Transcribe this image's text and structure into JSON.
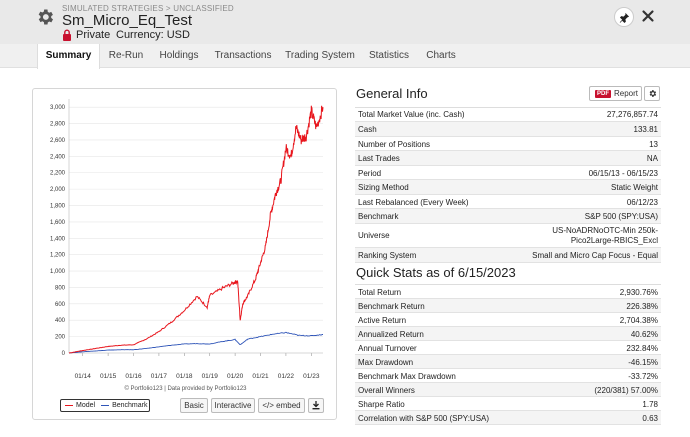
{
  "header": {
    "breadcrumb": "SIMULATED STRATEGIES > UNCLASSIFIED",
    "title": "Sm_Micro_Eq_Test",
    "privacy": "Private",
    "currency": "Currency: USD"
  },
  "tabs": [
    "Summary",
    "Re-Run",
    "Holdings",
    "Transactions",
    "Trading System",
    "Statistics",
    "Charts"
  ],
  "active_tab": "Summary",
  "chart": {
    "credit": "© Portfolio123 | Data provided by Portfolio123",
    "legend_model": "Model",
    "legend_benchmark": "Benchmark",
    "btn_basic": "Basic",
    "btn_interactive": "Interactive",
    "btn_embed": "</> embed",
    "colors": {
      "model": "#e8161d",
      "benchmark": "#2f55b8"
    }
  },
  "chart_data": {
    "type": "line",
    "x_ticks": [
      "01/14",
      "01/15",
      "01/16",
      "01/17",
      "01/18",
      "01/19",
      "01/20",
      "01/21",
      "01/22",
      "01/23"
    ],
    "y_ticks": [
      0,
      200,
      400,
      600,
      800,
      1000,
      1200,
      1400,
      1600,
      1800,
      2000,
      2200,
      2400,
      2600,
      2800,
      3000
    ],
    "ylim": [
      0,
      3100
    ],
    "x_range": [
      2013.46,
      2023.46
    ],
    "series": [
      {
        "name": "Model",
        "x": [
          2013.46,
          2014.0,
          2014.5,
          2015.0,
          2015.5,
          2016.0,
          2016.5,
          2017.0,
          2017.5,
          2018.0,
          2018.5,
          2018.9,
          2019.0,
          2019.5,
          2019.9,
          2020.1,
          2020.2,
          2020.3,
          2020.5,
          2020.8,
          2021.0,
          2021.2,
          2021.4,
          2021.6,
          2021.8,
          2022.0,
          2022.2,
          2022.4,
          2022.6,
          2022.8,
          2023.0,
          2023.2,
          2023.46
        ],
        "y": [
          0,
          30,
          55,
          80,
          95,
          100,
          170,
          260,
          380,
          520,
          690,
          560,
          700,
          790,
          850,
          880,
          400,
          600,
          700,
          900,
          1100,
          1300,
          1700,
          1950,
          2100,
          2500,
          2400,
          2750,
          2600,
          2650,
          2950,
          2750,
          3000
        ]
      },
      {
        "name": "Benchmark",
        "x": [
          2013.46,
          2014.0,
          2014.5,
          2015.0,
          2015.5,
          2016.0,
          2016.5,
          2017.0,
          2017.5,
          2018.0,
          2018.5,
          2019.0,
          2019.5,
          2020.0,
          2020.2,
          2020.5,
          2021.0,
          2021.5,
          2022.0,
          2022.5,
          2023.0,
          2023.46
        ],
        "y": [
          0,
          15,
          25,
          35,
          40,
          40,
          55,
          75,
          95,
          110,
          115,
          110,
          140,
          165,
          100,
          170,
          200,
          230,
          250,
          215,
          210,
          226
        ]
      }
    ]
  },
  "general_info": {
    "title": "General Info",
    "report_badge": "PDF",
    "report_label": "Report",
    "rows": [
      {
        "k": "Total Market Value (inc. Cash)",
        "v": "27,276,857.74"
      },
      {
        "k": "Cash",
        "v": "133.81"
      },
      {
        "k": "Number of Positions",
        "v": "13"
      },
      {
        "k": "Last Trades",
        "v": "NA"
      },
      {
        "k": "Period",
        "v": "06/15/13 - 06/15/23"
      },
      {
        "k": "Sizing Method",
        "v": "Static Weight"
      },
      {
        "k": "Last Rebalanced (Every Week)",
        "v": "06/12/23"
      },
      {
        "k": "Benchmark",
        "v": "S&P 500 (SPY:USA)"
      },
      {
        "k": "Universe",
        "v": "US-NoADRNoOTC-Min 250k-",
        "v2": "Pico2Large-RBICS_Excl"
      },
      {
        "k": "Ranking System",
        "v": "Small and Micro Cap Focus - Equal"
      }
    ]
  },
  "quick_stats": {
    "title": "Quick Stats as of 6/15/2023",
    "rows": [
      {
        "k": "Total Return",
        "v": "2,930.76%"
      },
      {
        "k": "Benchmark Return",
        "v": "226.38%"
      },
      {
        "k": "Active Return",
        "v": "2,704.38%"
      },
      {
        "k": "Annualized Return",
        "v": "40.62%"
      },
      {
        "k": "Annual Turnover",
        "v": "232.84%"
      },
      {
        "k": "Max Drawdown",
        "v": "-46.15%"
      },
      {
        "k": "Benchmark Max Drawdown",
        "v": "-33.72%"
      },
      {
        "k": "Overall Winners",
        "v": "(220/381) 57.00%"
      },
      {
        "k": "Sharpe Ratio",
        "v": "1.78"
      },
      {
        "k": "Correlation with S&P 500 (SPY:USA)",
        "v": "0.63"
      }
    ]
  }
}
